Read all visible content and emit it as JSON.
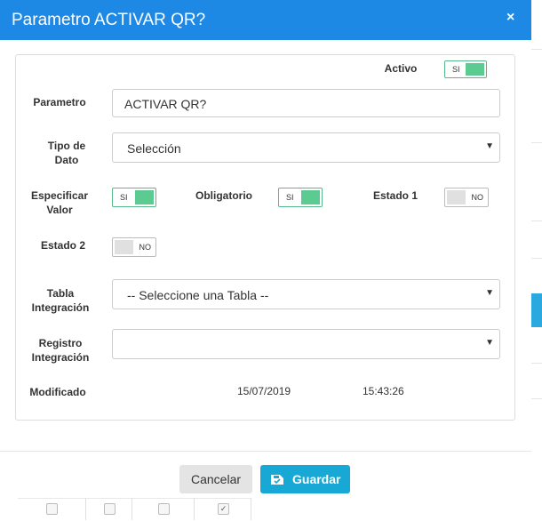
{
  "modal": {
    "title": "Parametro ACTIVAR QR?",
    "close_icon": "×"
  },
  "form": {
    "activo": {
      "label": "Activo",
      "toggle": "SI"
    },
    "parametro": {
      "label": "Parametro",
      "value": "ACTIVAR QR?"
    },
    "tipo_dato": {
      "label_line1": "Tipo de",
      "label_line2": "Dato",
      "value": "Selección"
    },
    "especificar_valor": {
      "label_line1": "Especificar",
      "label_line2": "Valor",
      "toggle": "SI"
    },
    "obligatorio": {
      "label": "Obligatorio",
      "toggle": "SI"
    },
    "estado1": {
      "label": "Estado 1",
      "toggle": "NO"
    },
    "estado2": {
      "label": "Estado 2",
      "toggle": "NO"
    },
    "tabla_integracion": {
      "label_line1": "Tabla",
      "label_line2": "Integración",
      "value": "-- Seleccione una Tabla --"
    },
    "registro_integracion": {
      "label_line1": "Registro",
      "label_line2": "Integración",
      "value": ""
    },
    "modificado": {
      "label": "Modificado",
      "date": "15/07/2019",
      "time": "15:43:26"
    }
  },
  "footer": {
    "cancel_label": "Cancelar",
    "save_label": "Guardar"
  },
  "background": {
    "checkbox_checked": "✓"
  },
  "colors": {
    "header": "#1e88e5",
    "toggle_on": "#5ccb91",
    "save_button": "#17a8d6"
  }
}
